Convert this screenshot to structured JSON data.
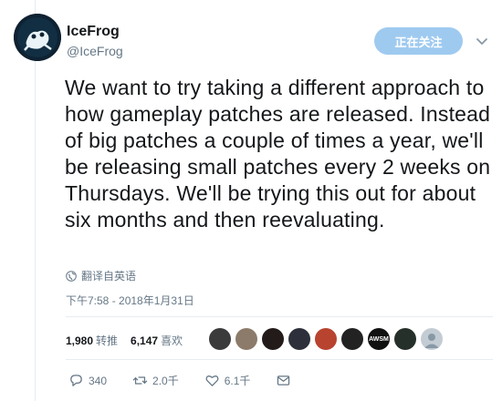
{
  "user": {
    "name": "IceFrog",
    "handle": "@IceFrog",
    "follow_label": "正在关注"
  },
  "tweet": {
    "text": "We want to try taking a different approach to how gameplay patches are released. Instead of big patches a couple of times a year, we'll be releasing small patches every 2 weeks on Thursdays. We'll be trying this out for about six months and then reevaluating.",
    "translate_label": "翻译自英语",
    "timestamp": "下午7:58 - 2018年1月31日"
  },
  "stats": {
    "retweets_count": "1,980",
    "retweets_label": "转推",
    "likes_count": "6,147",
    "likes_label": "喜欢"
  },
  "likers": [
    {
      "icon": "avatar-1",
      "color": "#3b3b3b"
    },
    {
      "icon": "avatar-2",
      "color": "#8c7b6a"
    },
    {
      "icon": "avatar-3",
      "color": "#231b1a"
    },
    {
      "icon": "avatar-4",
      "color": "#2d2f3a"
    },
    {
      "icon": "avatar-5",
      "color": "#b8432f"
    },
    {
      "icon": "avatar-6",
      "color": "#222222"
    },
    {
      "icon": "avatar-awsm",
      "color": "#111111",
      "label": "AWSM"
    },
    {
      "icon": "avatar-8",
      "color": "#26302a"
    },
    {
      "icon": "avatar-default",
      "color": "#c3ccd3"
    }
  ],
  "actions": {
    "reply_count": "340",
    "retweet_count": "2.0千",
    "like_count": "6.1千"
  },
  "colors": {
    "accent": "#1da1f2",
    "follow_bg": "#9fcaf0",
    "muted": "#657786"
  }
}
